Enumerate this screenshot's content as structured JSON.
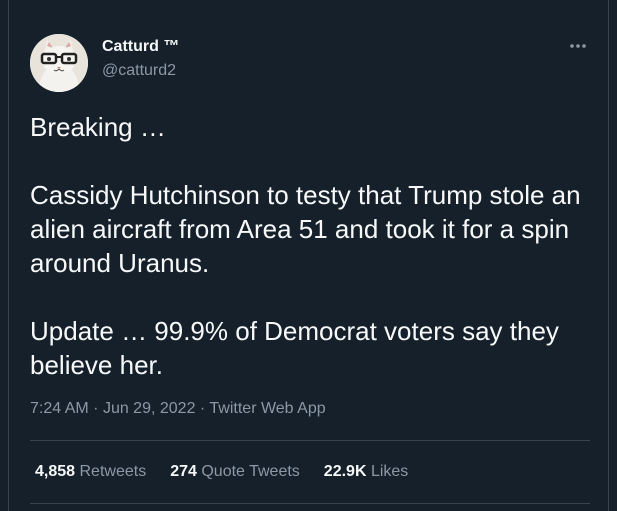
{
  "tweet": {
    "author": {
      "display_name": "Catturd ™",
      "handle": "@catturd2",
      "avatar_icon": "cat-with-glasses-avatar"
    },
    "more_icon": "more-options-icon",
    "text": {
      "lead": "Breaking …",
      "body": "Cassidy Hutchinson to testy that Trump stole an alien aircraft from Area 51 and took it for a spin around Uranus.",
      "update": "Update … 99.9% of Democrat voters say they believe her."
    },
    "meta": {
      "time": "7:24 AM",
      "separator1": "·",
      "date": "Jun 29, 2022",
      "separator2": "·",
      "source": "Twitter Web App"
    },
    "stats": {
      "retweets_count": "4,858",
      "retweets_label": "Retweets",
      "quotes_count": "274",
      "quotes_label": "Quote Tweets",
      "likes_count": "22.9K",
      "likes_label": "Likes"
    }
  },
  "colors": {
    "background": "#15202b",
    "text_primary": "#f7f9f9",
    "text_secondary": "#8b98a5",
    "divider": "#38444d"
  }
}
